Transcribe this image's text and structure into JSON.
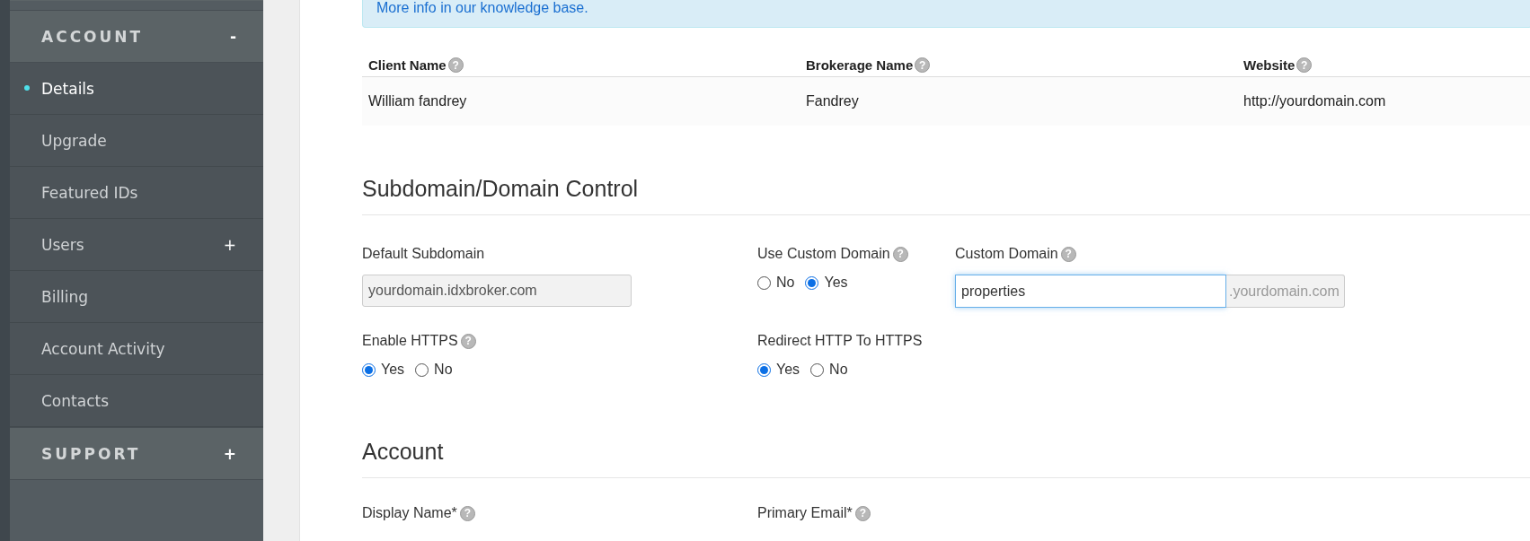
{
  "sidebar": {
    "sections": [
      {
        "title": "ACCOUNT",
        "sign": "-",
        "items": [
          {
            "label": "Details",
            "selected": true
          },
          {
            "label": "Upgrade",
            "selected": false
          },
          {
            "label": "Featured IDs",
            "selected": false
          },
          {
            "label": "Users",
            "selected": false,
            "sign": "+"
          },
          {
            "label": "Billing",
            "selected": false
          },
          {
            "label": "Account Activity",
            "selected": false
          },
          {
            "label": "Contacts",
            "selected": false
          }
        ]
      },
      {
        "title": "SUPPORT",
        "sign": "+"
      }
    ]
  },
  "info_box": {
    "link": "More info in our knowledge base."
  },
  "client_table": {
    "columns": [
      {
        "label": "Client Name",
        "help": "?"
      },
      {
        "label": "Brokerage Name",
        "help": "?"
      },
      {
        "label": "Website",
        "help": "?"
      }
    ],
    "rows": [
      [
        "William fandrey",
        "Fandrey",
        "http://yourdomain.com"
      ]
    ]
  },
  "domain_section": {
    "title": "Subdomain/Domain Control",
    "fields": [
      {
        "kind": "text",
        "label": "Default Subdomain",
        "value": "yourdomain.idxbroker.com",
        "disabled": true
      },
      {
        "kind": "radio",
        "label": "Use Custom Domain",
        "help": "?",
        "options": [
          {
            "label": "No",
            "selected": false
          },
          {
            "label": "Yes",
            "selected": true
          }
        ]
      },
      {
        "kind": "addon",
        "label": "Custom Domain",
        "help": "?",
        "value": "properties",
        "focused": true,
        "suffix": ".yourdomain.com"
      },
      {
        "kind": "radio",
        "label": "Enable HTTPS",
        "help": "?",
        "options": [
          {
            "label": "Yes",
            "selected": true
          },
          {
            "label": "No",
            "selected": false
          }
        ]
      },
      {
        "kind": "radio",
        "label": "Redirect HTTP To HTTPS",
        "options": [
          {
            "label": "Yes",
            "selected": true
          },
          {
            "label": "No",
            "selected": false
          }
        ]
      }
    ]
  },
  "account_section": {
    "title": "Account",
    "fields": [
      {
        "label": "Display Name*",
        "help": "?"
      },
      {
        "label": "Primary Email*",
        "help": "?"
      }
    ]
  }
}
